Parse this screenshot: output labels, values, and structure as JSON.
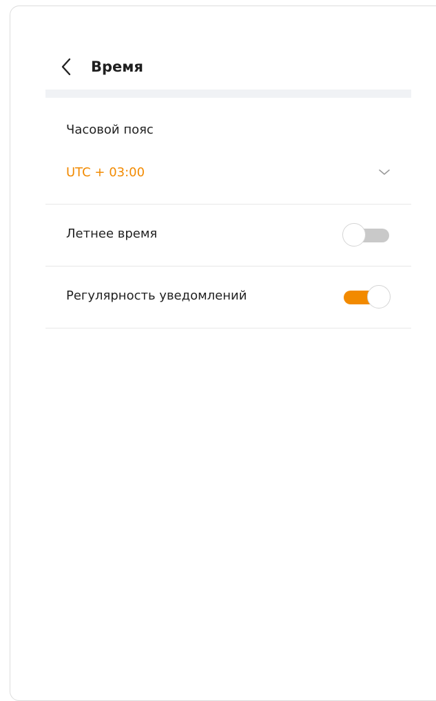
{
  "header": {
    "back_icon": "chevron-left-icon",
    "title": "Время"
  },
  "timezone": {
    "label": "Часовой пояс",
    "value": "UTC + 03:00",
    "dropdown_icon": "chevron-down-icon",
    "value_color": "#f28a00"
  },
  "daylight_saving": {
    "label": "Летнее время",
    "enabled": false
  },
  "notifications_regularity": {
    "label": "Регулярность уведомлений",
    "enabled": true
  },
  "colors": {
    "accent": "#f28a00",
    "toggle_off": "#c9c9c9",
    "divider": "#e7e7e7"
  }
}
